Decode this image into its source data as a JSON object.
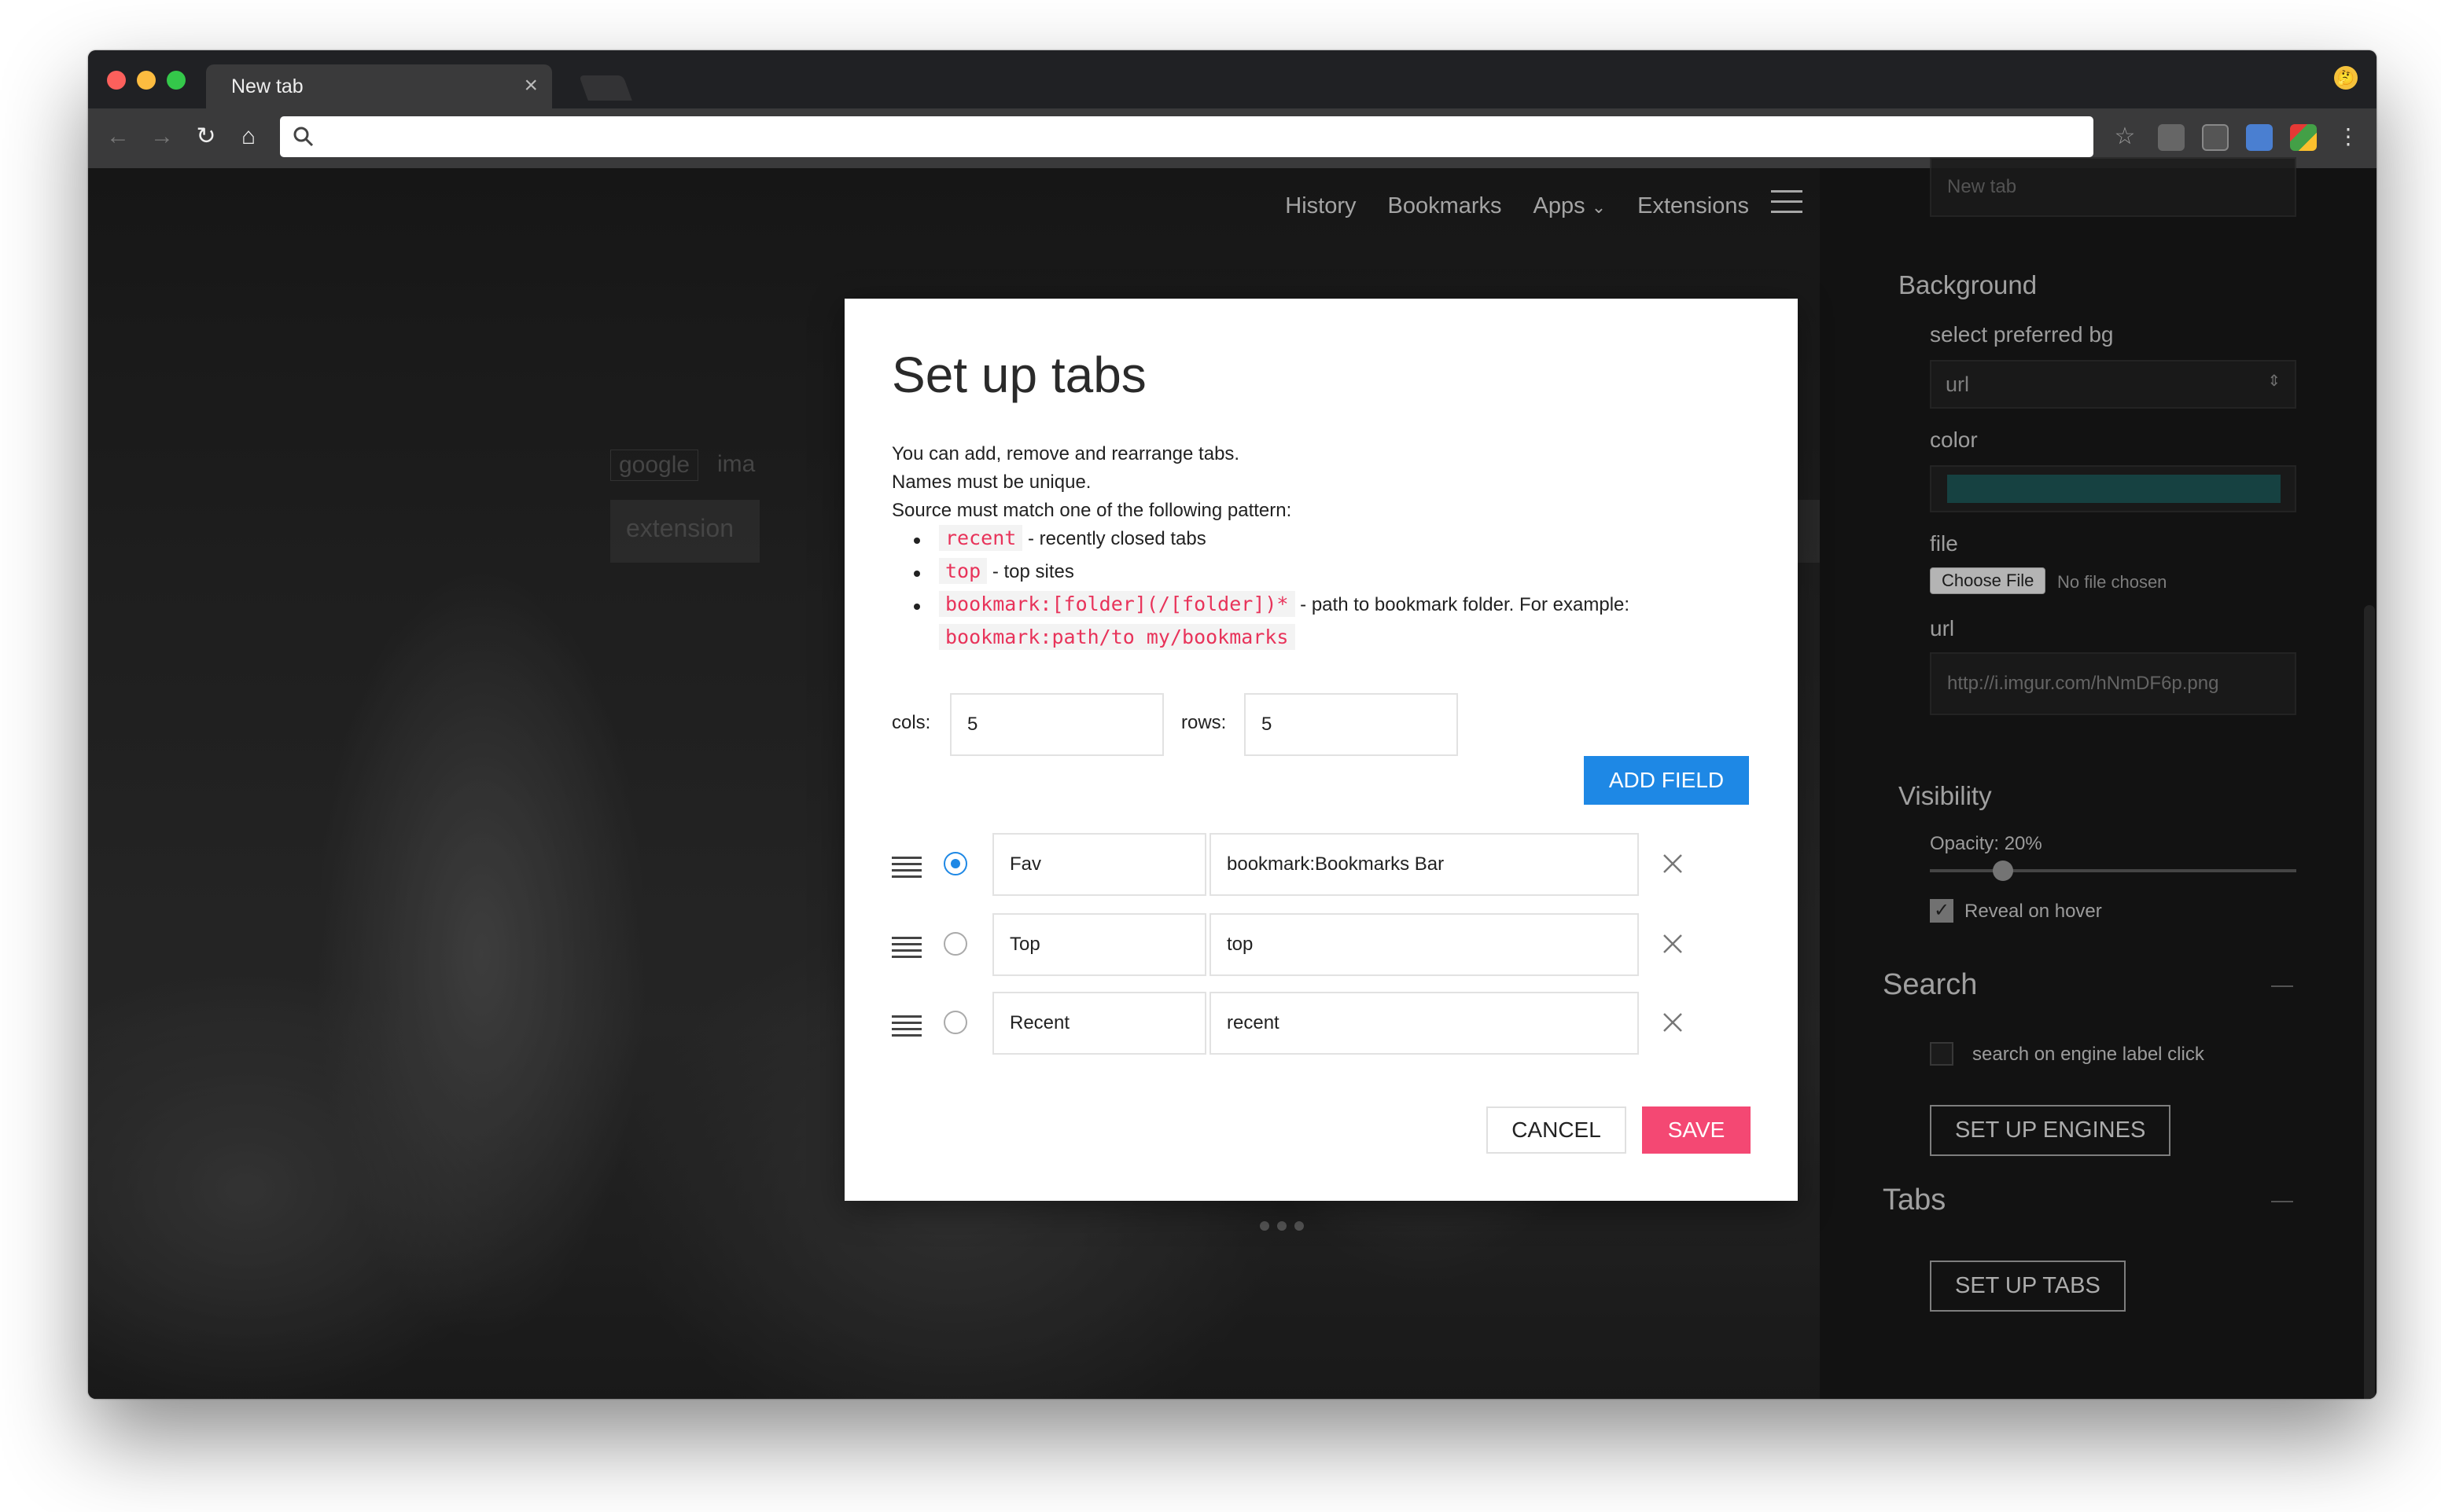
{
  "browser": {
    "tab_title": "New tab",
    "tab_close": "×",
    "omnibox_value": ""
  },
  "topnav": {
    "history": "History",
    "bookmarks": "Bookmarks",
    "apps": "Apps",
    "extensions": "Extensions"
  },
  "background_ghosts": {
    "tag1": "google",
    "tag2": "ima",
    "field": "extension"
  },
  "sidepanel": {
    "top_input_placeholder": "New tab",
    "background_heading": "Background",
    "select_bg_label": "select preferred bg",
    "select_bg_value": "url",
    "color_label": "color",
    "color_value": "#1b5050",
    "file_label": "file",
    "choose_file_button": "Choose File",
    "no_file_text": "No file chosen",
    "url_label": "url",
    "url_placeholder": "http://i.imgur.com/hNmDF6p.png",
    "visibility_heading": "Visibility",
    "opacity_label": "Opacity: 20%",
    "opacity_value": 0.2,
    "reveal_on_hover_label": "Reveal on hover",
    "search_heading": "Search",
    "search_on_label_click": "search on engine label click",
    "set_up_engines_button": "SET UP ENGINES",
    "tabs_heading": "Tabs",
    "set_up_tabs_button": "SET UP TABS"
  },
  "modal": {
    "title": "Set up tabs",
    "intro_line1": "You can add, remove and rearrange tabs.",
    "intro_line2": "Names must be unique.",
    "intro_line3": "Source must match one of the following pattern:",
    "patterns": [
      {
        "code": "recent",
        "desc": "- recently closed tabs"
      },
      {
        "code": "top",
        "desc": "- top sites"
      },
      {
        "code": "bookmark:[folder](/[folder])*",
        "desc": "- path to bookmark folder. For example:",
        "example": "bookmark:path/to my/bookmarks"
      }
    ],
    "cols_label": "cols:",
    "cols_value": "5",
    "rows_label": "rows:",
    "rows_value": "5",
    "add_field_button": "ADD FIELD",
    "rows": [
      {
        "name": "Fav",
        "source": "bookmark:Bookmarks Bar",
        "selected": true
      },
      {
        "name": "Top",
        "source": "top",
        "selected": false
      },
      {
        "name": "Recent",
        "source": "recent",
        "selected": false
      }
    ],
    "cancel_button": "CANCEL",
    "save_button": "SAVE"
  },
  "colors": {
    "primary": "#1e88e5",
    "save": "#f44873",
    "code": "#e8335a"
  }
}
